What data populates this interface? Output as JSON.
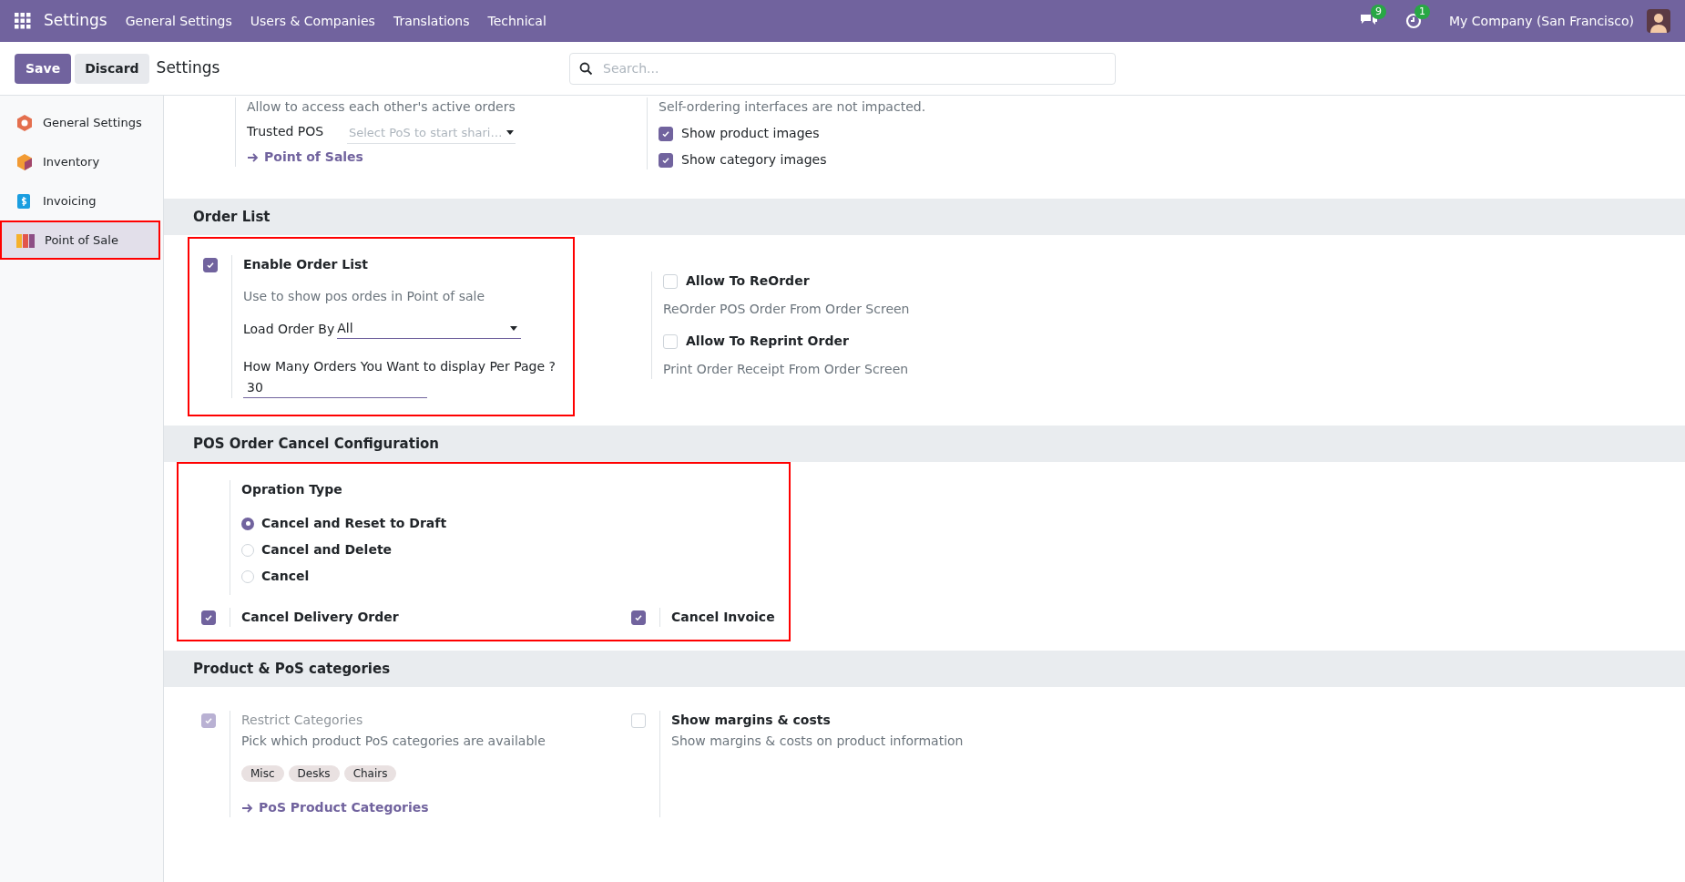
{
  "topbar": {
    "app_title": "Settings",
    "menu": [
      "General Settings",
      "Users & Companies",
      "Translations",
      "Technical"
    ],
    "messages_badge": "9",
    "activity_badge": "1",
    "company": "My Company (San Francisco)"
  },
  "control_panel": {
    "save": "Save",
    "discard": "Discard",
    "breadcrumb": "Settings",
    "search_placeholder": "Search..."
  },
  "sidebar": {
    "items": [
      {
        "label": "General Settings",
        "selected": false,
        "highlighted": false
      },
      {
        "label": "Inventory",
        "selected": false,
        "highlighted": false
      },
      {
        "label": "Invoicing",
        "selected": false,
        "highlighted": false
      },
      {
        "label": "Point of Sale",
        "selected": true,
        "highlighted": true
      }
    ]
  },
  "top_block": {
    "left": {
      "description": "Allow to access each other's active orders",
      "field_label": "Trusted POS",
      "field_placeholder": "Select PoS to start shari…",
      "link": "Point of Sales"
    },
    "right": {
      "description": "Self-ordering interfaces are not impacted.",
      "options": [
        {
          "label": "Show product images",
          "checked": true
        },
        {
          "label": "Show category images",
          "checked": true
        }
      ]
    }
  },
  "order_list": {
    "title": "Order List",
    "highlighted": true,
    "enable": {
      "label": "Enable Order List",
      "checked": true,
      "description": "Use to show pos ordes in Point of sale"
    },
    "load_order_by": {
      "label": "Load Order By",
      "value": "All"
    },
    "per_page": {
      "label": "How Many Orders You Want to display Per Page ?",
      "value": "30"
    },
    "right": [
      {
        "label": "Allow To ReOrder",
        "checked": false,
        "description": "ReOrder POS Order From Order Screen"
      },
      {
        "label": "Allow To Reprint Order",
        "checked": false,
        "description": "Print Order Receipt From Order Screen"
      }
    ]
  },
  "cancel_config": {
    "title": "POS Order Cancel Configuration",
    "highlighted": true,
    "operation_type": {
      "label": "Opration Type",
      "options": [
        {
          "label": "Cancel and Reset to Draft",
          "selected": true
        },
        {
          "label": "Cancel and Delete",
          "selected": false
        },
        {
          "label": "Cancel",
          "selected": false
        }
      ]
    },
    "delivery": {
      "label": "Cancel Delivery Order",
      "checked": true
    },
    "invoice": {
      "label": "Cancel Invoice",
      "checked": true
    }
  },
  "categories": {
    "title": "Product & PoS categories",
    "restrict": {
      "label": "Restrict Categories",
      "checked": true,
      "disabled": true,
      "description": "Pick which product PoS categories are available",
      "tags": [
        "Misc",
        "Desks",
        "Chairs"
      ],
      "link": "PoS Product Categories"
    },
    "margins": {
      "label": "Show margins & costs",
      "checked": false,
      "description": "Show margins & costs on product information"
    }
  }
}
